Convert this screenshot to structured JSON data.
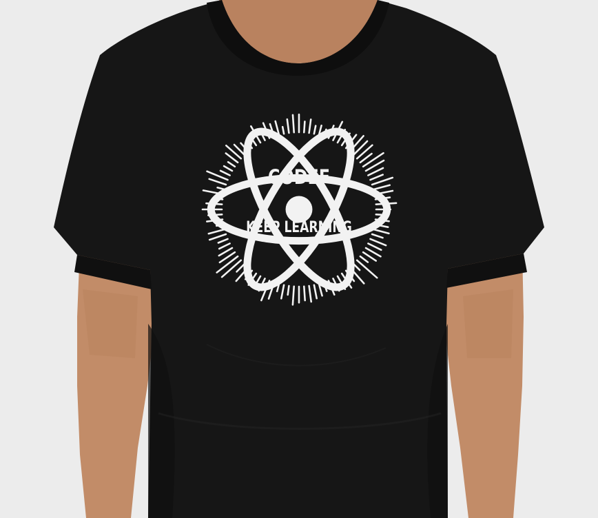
{
  "print": {
    "brand": "CODEF",
    "slogan": "KEEP LEARNING",
    "icon": "atom-icon"
  },
  "colors": {
    "background": "#ececec",
    "shirt": "#161616",
    "skin": "#c08a67",
    "print": "#f2f2f2"
  }
}
